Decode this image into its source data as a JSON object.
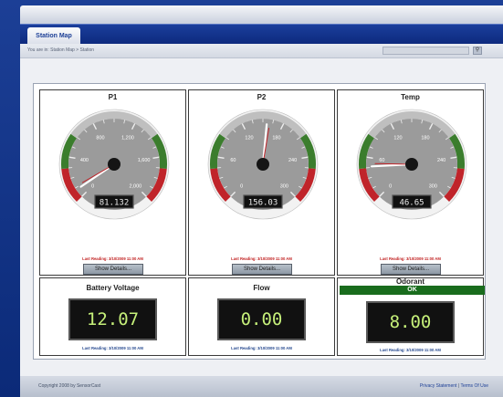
{
  "nav": {
    "tab_label": "Station Map"
  },
  "breadcrumb": {
    "text": "You are in: Station Map > Station"
  },
  "search": {
    "icon": "search-icon"
  },
  "gauges": [
    {
      "title": "P1",
      "ticks": [
        "0",
        "400",
        "800",
        "1,200",
        "1,600",
        "2,000"
      ],
      "max": 2000,
      "value": 81.32,
      "display": "81.132",
      "reading": "Last Reading: 3/10/2009 11:00 AM",
      "reading_color": "#c01f1f",
      "button": "Show Details..."
    },
    {
      "title": "P2",
      "ticks": [
        "0",
        "60",
        "120",
        "180",
        "240",
        "300"
      ],
      "max": 300,
      "value": 156.03,
      "display": "156.03",
      "reading": "Last Reading: 3/10/2009 11:00 AM",
      "reading_color": "#c01f1f",
      "button": "Show Details..."
    },
    {
      "title": "Temp",
      "ticks": [
        "0",
        "60",
        "120",
        "180",
        "240",
        "300"
      ],
      "max": 300,
      "value": 46.65,
      "display": "46.65",
      "reading": "Last Reading: 3/10/2009 11:00 AM",
      "reading_color": "#c01f1f",
      "button": "Show Details..."
    }
  ],
  "meters": [
    {
      "title": "Battery Voltage",
      "value": "12.07",
      "reading": "Last Reading: 3/10/2009 11:00 AM"
    },
    {
      "title": "Flow",
      "value": "0.00",
      "reading": "Last Reading: 3/10/2009 11:00 AM"
    },
    {
      "title": "Odorant",
      "status": "OK",
      "value": "8.00",
      "reading": "Last Reading: 3/10/2009 11:00 AM"
    }
  ],
  "footer": {
    "copyright": "Copyright 2008 by SensorCast",
    "privacy": "Privacy Statement",
    "separator": "|",
    "terms": "Terms Of Use"
  },
  "colors": {
    "brand_blue": "#1c3f96",
    "gauge_red": "#c0242a",
    "gauge_green": "#3b7d2d",
    "lcd_text": "#c6f07a",
    "ok_green": "#196c1d"
  }
}
